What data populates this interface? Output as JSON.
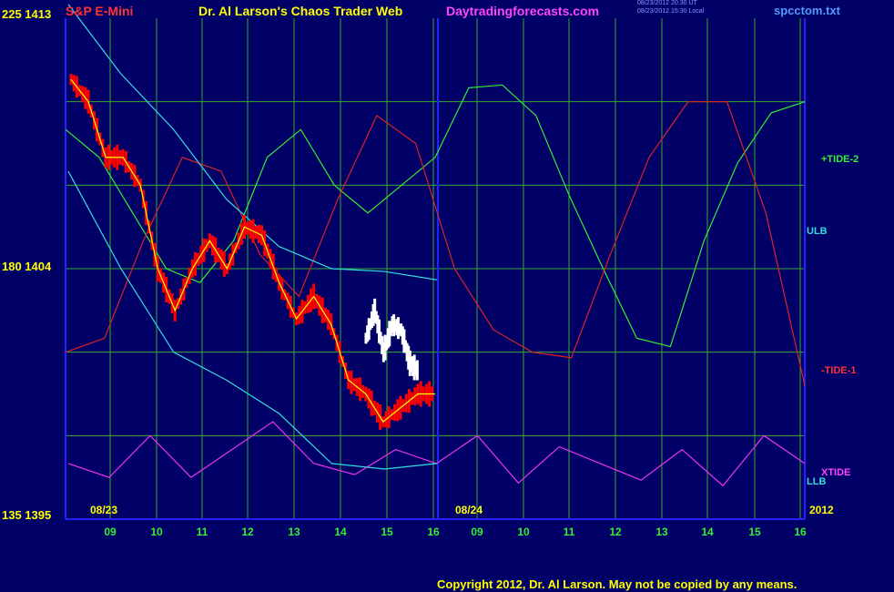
{
  "header": {
    "instrument": "S&P E-Mini",
    "title": "Dr. Al Larson's Chaos Trader Web",
    "site": "Daytradingforecasts.com",
    "time1": "08/23/2012 20:30 UT",
    "time2": "08/23/2012 15:30 Local",
    "file": "spcctom.txt"
  },
  "y_labels": {
    "top": "225 1413",
    "mid": "180 1404",
    "bottom": "135 1395"
  },
  "right_labels": {
    "tide2": "+TIDE-2",
    "ulb": "ULB",
    "tide1": "-TIDE-1",
    "xtide": "XTIDE",
    "llb": "LLB"
  },
  "date_labels": {
    "d1": "08/23",
    "d2": "08/24",
    "year": "2012"
  },
  "copyright": "Copyright 2012, Dr. Al Larson. May not be copied by any means.",
  "colors": {
    "background": "#000066",
    "grid": "#33aa33",
    "border": "#2222ff",
    "price": "#ff0000",
    "price_live": "#ffffff",
    "avg": "#ffff00",
    "bands": "#33dddd",
    "tide1": "#dd2222",
    "tide2": "#33ee33",
    "xtide": "#ee33ee"
  },
  "chart_data": {
    "type": "line",
    "title": "S&P E-Mini",
    "x_ticks": [
      "09",
      "10",
      "11",
      "12",
      "13",
      "14",
      "15",
      "16",
      "09",
      "10",
      "11",
      "12",
      "13",
      "14",
      "15",
      "16"
    ],
    "y_axis_left_ticks": [
      135,
      180,
      225
    ],
    "y_axis_right_ticks": [
      1395,
      1404,
      1413
    ],
    "ylim": [
      1395,
      1413
    ],
    "grid": true,
    "series": [
      {
        "name": "+TIDE-2",
        "kind": "forecast",
        "values": [
          1409,
          1408,
          1406,
          1404,
          1403.5,
          1405,
          1408,
          1409,
          1407,
          1406,
          1407,
          1408,
          1410.5,
          1410.6,
          1409.5,
          1406.6,
          1404,
          1401.5,
          1401.2,
          1405,
          1407.8,
          1409.6,
          1410
        ]
      },
      {
        "name": "-TIDE-1",
        "kind": "forecast",
        "values": [
          1401,
          1401.5,
          1405,
          1408,
          1407.5,
          1404.5,
          1403,
          1406.5,
          1409.5,
          1408.5,
          1404,
          1401.8,
          1401,
          1400.8,
          1404.5,
          1408,
          1410,
          1410,
          1406,
          1399.8
        ]
      },
      {
        "name": "XTIDE",
        "kind": "oscillator",
        "values": [
          1397,
          1396.5,
          1398,
          1396.5,
          1397.5,
          1398.5,
          1397,
          1396.6,
          1397.5,
          1397,
          1398,
          1396.3,
          1397.6,
          1397,
          1396.4,
          1397.5,
          1396.2,
          1398,
          1397
        ]
      },
      {
        "name": "ULB",
        "kind": "band",
        "values": [
          1413.5,
          1411,
          1409,
          1406.5,
          1404.8,
          1404,
          1403.9,
          1403.6
        ]
      },
      {
        "name": "LLB",
        "kind": "band",
        "values": [
          1407.5,
          1404,
          1401,
          1400,
          1398.8,
          1397,
          1396.8,
          1397
        ]
      },
      {
        "name": "S&P E-Mini",
        "kind": "price",
        "values": [
          1410.8,
          1410,
          1408,
          1408,
          1407,
          1404,
          1402.5,
          1404,
          1405,
          1404,
          1405.5,
          1405.2,
          1403.5,
          1402.2,
          1403,
          1402,
          1400,
          1399.5,
          1398.5,
          1399,
          1399.5,
          1399.5
        ]
      },
      {
        "name": "S&P E-Mini",
        "kind": "price-live",
        "values": [
          1401.5,
          1402.5,
          1401,
          1402,
          1401.8,
          1400.6,
          1400.3
        ]
      }
    ]
  }
}
